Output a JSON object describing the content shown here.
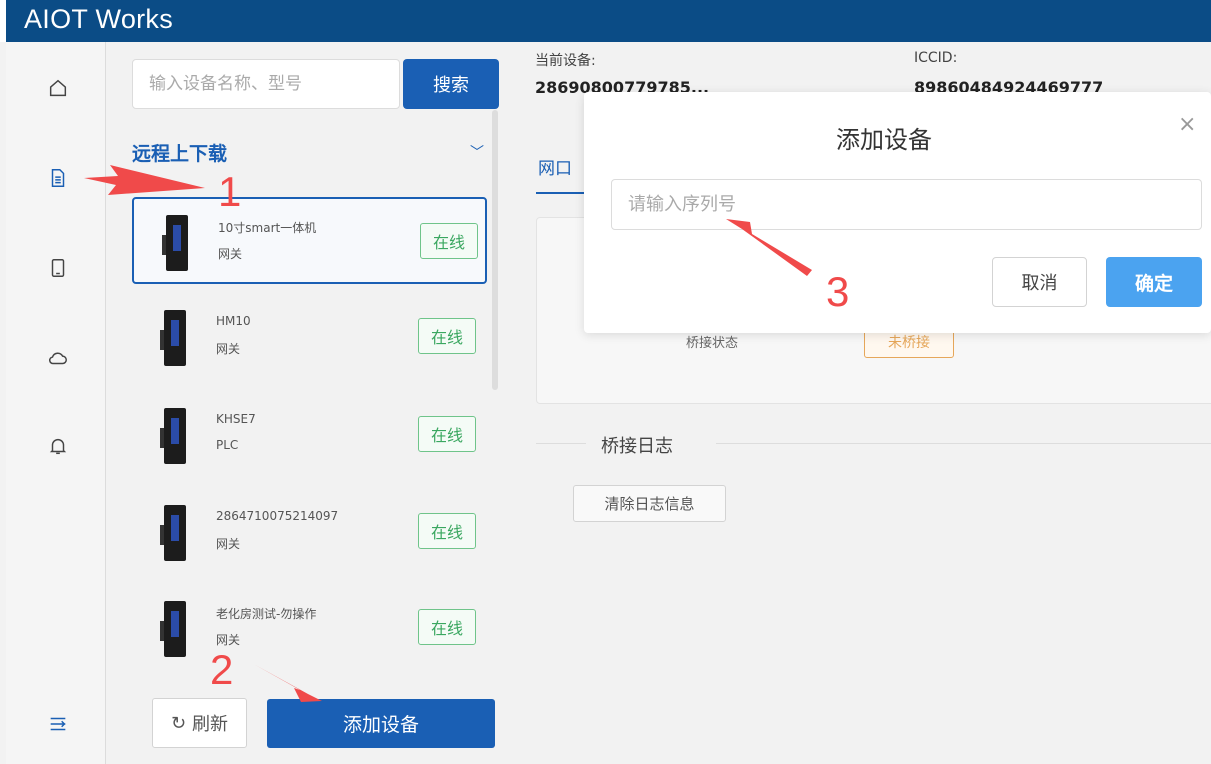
{
  "app": {
    "title": "AIOT Works"
  },
  "sidebar": {
    "items": [
      {
        "icon": "home-icon"
      },
      {
        "icon": "document-icon"
      },
      {
        "icon": "tablet-icon"
      },
      {
        "icon": "cloud-icon"
      },
      {
        "icon": "bell-icon"
      },
      {
        "icon": "collapse-menu-icon"
      }
    ]
  },
  "device_panel": {
    "search_placeholder": "输入设备名称、型号",
    "search_label": "搜索",
    "group_title": "远程上下载",
    "devices": [
      {
        "name": "10寸smart一体机",
        "type": "网关",
        "status": "在线",
        "selected": true
      },
      {
        "name": "HM10",
        "type": "网关",
        "status": "在线"
      },
      {
        "name": "KHSE7",
        "type": "PLC",
        "status": "在线"
      },
      {
        "name": "2864710075214097",
        "type": "网关",
        "status": "在线"
      },
      {
        "name": "老化房测试-勿操作",
        "type": "网关",
        "status": "在线"
      }
    ],
    "refresh_label": "刷新",
    "add_device_label": "添加设备"
  },
  "main": {
    "current_device_label": "当前设备:",
    "current_device_value": "28690800779785...",
    "iccid_label": "ICCID:",
    "iccid_value": "89860484924469777",
    "tab_label": "网口",
    "bridge_status_label": "桥接状态",
    "bridge_status_value": "未桥接",
    "log_title": "桥接日志",
    "clear_log_label": "清除日志信息"
  },
  "modal": {
    "title": "添加设备",
    "close_symbol": "×",
    "serial_placeholder": "请输入序列号",
    "cancel_label": "取消",
    "confirm_label": "确定"
  },
  "annotations": {
    "step1": "1",
    "step2": "2",
    "step3": "3",
    "color": "#f04a4a"
  },
  "colors": {
    "brand": "#0b4c86",
    "primary": "#1a5fb4",
    "confirm": "#4ba3f0",
    "online": "#3aa760",
    "warning": "#e6a75a"
  }
}
